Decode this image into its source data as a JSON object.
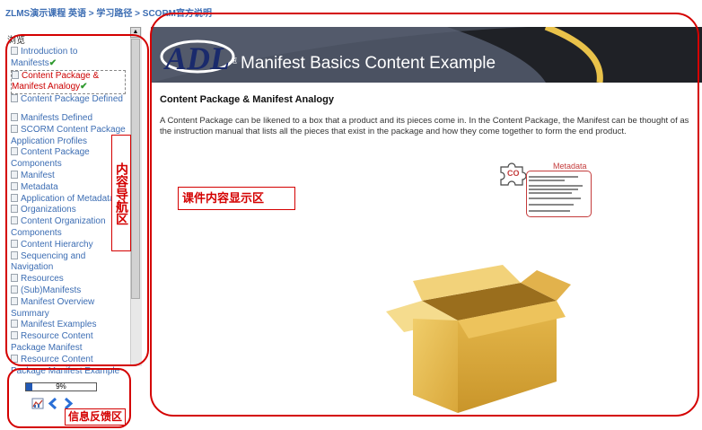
{
  "breadcrumb": "ZLMS演示课程 英语 > 学习路径 > SCORM官方说明",
  "nav": {
    "title": "浏览",
    "items": [
      {
        "label": "Introduction to Manifests",
        "done": true
      },
      {
        "label": "Content Package & Manifest Analogy",
        "done": true,
        "active": true
      },
      {
        "label": "Content Package Defined",
        "done": false
      },
      {
        "label": "Manifests Defined",
        "done": false,
        "gap_before": true
      },
      {
        "label": "SCORM Content Package Application Profiles",
        "done": false
      },
      {
        "label": "Content Package Components",
        "done": false
      },
      {
        "label": "Manifest",
        "done": false
      },
      {
        "label": "Metadata",
        "done": false
      },
      {
        "label": "Application of Metadata",
        "done": false
      },
      {
        "label": "Organizations",
        "done": false
      },
      {
        "label": "Content Organization Components",
        "done": false
      },
      {
        "label": "Content Hierarchy",
        "done": false
      },
      {
        "label": "Sequencing and Navigation",
        "done": false
      },
      {
        "label": "Resources",
        "done": false
      },
      {
        "label": "(Sub)Manifests",
        "done": false
      },
      {
        "label": "Manifest Overview Summary",
        "done": false
      },
      {
        "label": "Manifest Examples",
        "done": false
      },
      {
        "label": "Resource Content Package Manifest",
        "done": false
      },
      {
        "label": "Resource Content Package Manifest Example",
        "done": false
      }
    ],
    "annotation": "内容导航区"
  },
  "feedback": {
    "progress_percent": 9,
    "progress_text": "9%",
    "chart_icon": "bar-chart-icon",
    "prev_icon": "chevron-left-icon",
    "next_icon": "chevron-right-icon",
    "annotation": "信息反馈区"
  },
  "content": {
    "banner_title": "Manifest Basics Content Example",
    "heading": "Content Package & Manifest Analogy",
    "body": "A Content Package can be likened to a box that a product and its pieces come in. In the Content Package, the Manifest can be thought of as the instruction manual that lists all the pieces that exist in the package and how they come together to form the end product.",
    "annotation": "课件内容显示区",
    "metadata_label": "Metadata",
    "puzzle_label": "CO"
  },
  "colors": {
    "annotation_red": "#d40000",
    "link_blue": "#3c6db3",
    "progress_blue": "#2259b5",
    "done_check_green": "#2f9a2f"
  }
}
